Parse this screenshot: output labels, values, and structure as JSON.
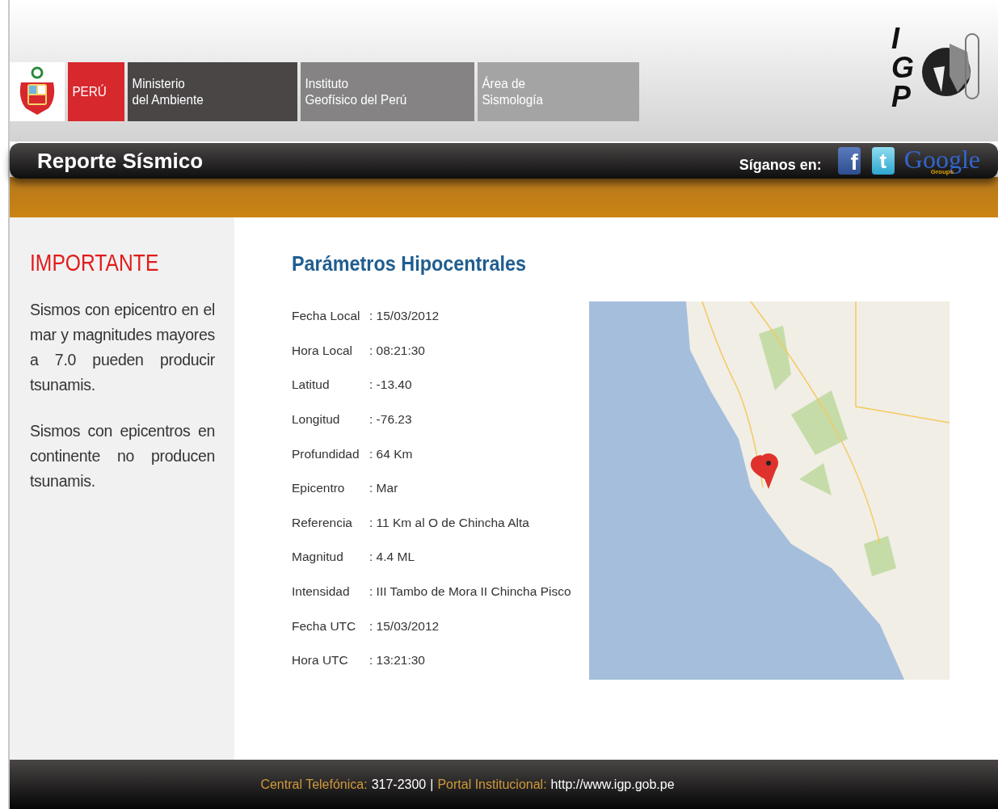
{
  "header": {
    "brand_blocks": [
      {
        "kind": "country",
        "lines": [
          "PERÚ"
        ]
      },
      {
        "kind": "dark",
        "lines": [
          "Ministerio",
          "del Ambiente"
        ]
      },
      {
        "kind": "mid",
        "lines": [
          "Instituto",
          "Geofísico del Perú"
        ]
      },
      {
        "kind": "light",
        "lines": [
          "Área de",
          "Sismología"
        ]
      }
    ],
    "logo": {
      "letters": [
        "I",
        "G",
        "P"
      ]
    }
  },
  "title_bar": {
    "title": "Reporte Sísmico",
    "follow_label": "Síganos en:",
    "social": [
      {
        "kind": "facebook",
        "glyph": "f"
      },
      {
        "kind": "twitter",
        "glyph": "t"
      },
      {
        "kind": "google",
        "glyph": "Google",
        "sub": "Groups"
      }
    ]
  },
  "sidebar": {
    "heading": "IMPORTANTE",
    "paragraphs": [
      "Sismos con epicentro en el mar y magnitudes mayores a 7.0 pueden producir tsunamis.",
      "Sismos con epicentros en continente no producen tsunamis."
    ]
  },
  "main": {
    "heading": "Parámetros Hipocentrales",
    "parameters": [
      {
        "label": "Fecha Local",
        "value": ": 15/03/2012"
      },
      {
        "label": "Hora Local",
        "value": ": 08:21:30"
      },
      {
        "label": "Latitud",
        "value": ": -13.40"
      },
      {
        "label": "Longitud",
        "value": ": -76.23"
      },
      {
        "label": "Profundidad",
        "value": ": 64 Km"
      },
      {
        "label": "Epicentro",
        "value": ": Mar"
      },
      {
        "label": "Referencia",
        "value": ": 11 Km al O de Chincha Alta"
      },
      {
        "label": "Magnitud",
        "value": ": 4.4 ML"
      },
      {
        "label": "Intensidad",
        "value": ": III Tambo de Mora II Chincha Pisco"
      },
      {
        "label": "Fecha UTC",
        "value": ": 15/03/2012"
      },
      {
        "label": "Hora UTC",
        "value": ": 13:21:30"
      }
    ]
  },
  "footer": [
    {
      "kind": "label",
      "text": "Central Telefónica:"
    },
    {
      "kind": "value",
      "text": "317-2300"
    },
    {
      "kind": "sep",
      "text": "|"
    },
    {
      "kind": "label",
      "text": "Portal Institucional:"
    },
    {
      "kind": "value",
      "text": "http://www.igp.gob.pe"
    }
  ]
}
